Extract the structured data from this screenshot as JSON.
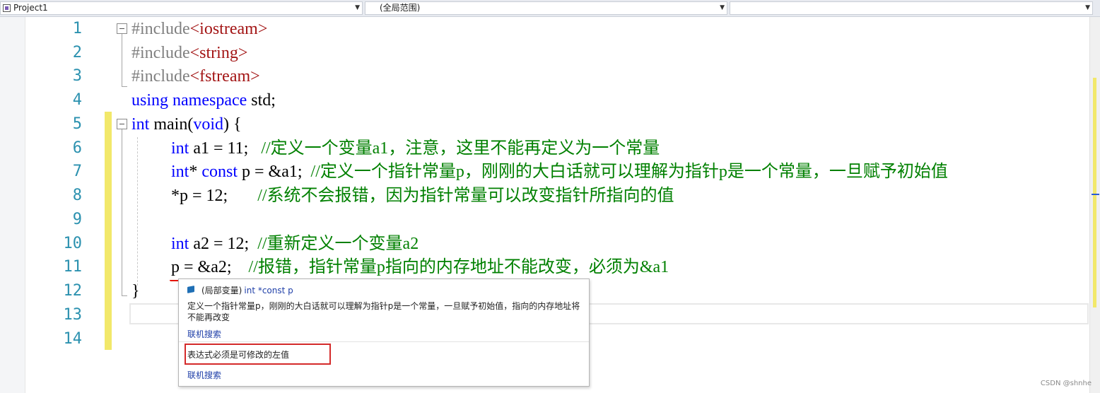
{
  "navbar": {
    "project": "Project1",
    "scope": "(全局范围)",
    "member": ""
  },
  "line_numbers": [
    "1",
    "2",
    "3",
    "4",
    "5",
    "6",
    "7",
    "8",
    "9",
    "10",
    "11",
    "12",
    "13",
    "14"
  ],
  "code": {
    "l1_a": "#include",
    "l1_b": "<iostream>",
    "l2_a": "#include",
    "l2_b": "<string>",
    "l3_a": "#include",
    "l3_b": "<fstream>",
    "l4_kw1": "using",
    "l4_kw2": "namespace",
    "l4_rest": " std;",
    "l5_kw": "int",
    "l5_mid": " main(",
    "l5_kw2": "void",
    "l5_end": ") {",
    "l6_kw": "int",
    "l6_code": " a1 = 11;   ",
    "l6_cm": "//定义一个变量a1，注意，这里不能再定义为一个常量",
    "l7_kw": "int",
    "l7_mid": "* ",
    "l7_kw2": "const",
    "l7_code": " p = &a1;  ",
    "l7_cm": "//定义一个指针常量p，刚刚的大白话就可以理解为指针p是一个常量，一旦赋予初始值",
    "l8_code": "*p = 12;       ",
    "l8_cm": "//系统不会报错，因为指针常量可以改变指针所指向的值",
    "l10_kw": "int",
    "l10_code": " a2 = 12;  ",
    "l10_cm": "//重新定义一个变量a2",
    "l11_code": "p = &a2;    ",
    "l11_cm": "//报错，指针常量p指向的内存地址不能改变，必须为&a1",
    "l12_code": "}"
  },
  "tooltip": {
    "tag": "(局部变量)",
    "signature": "int *const p",
    "description": "定义一个指针常量p，刚刚的大白话就可以理解为指针p是一个常量，一旦赋予初始值，指向的内存地址将不能再改变",
    "link1": "联机搜索",
    "error": "表达式必须是可修改的左值",
    "link2": "联机搜索"
  },
  "watermark": "CSDN @shnhe",
  "colors": {
    "keyword": "#0000ff",
    "comment": "#008000",
    "string": "#a31515",
    "preprocessor": "#808080",
    "line_number": "#2b91af",
    "change_marker": "#f2e86a",
    "error_squiggle": "#e51400",
    "error_highlight_box": "#d42a2a"
  }
}
